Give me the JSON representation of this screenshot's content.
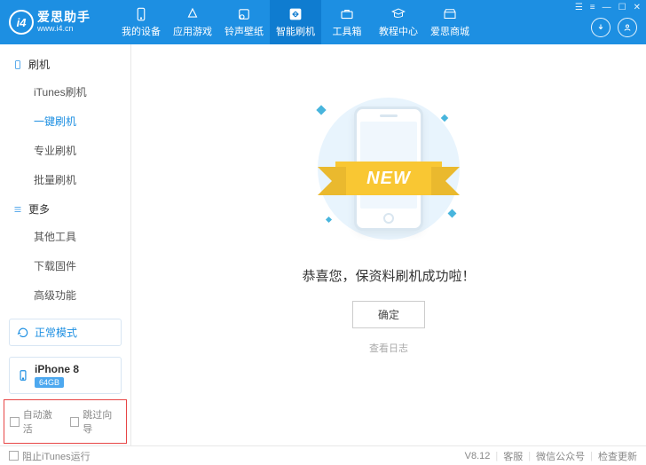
{
  "header": {
    "logo_initials": "i4",
    "logo_title": "爱思助手",
    "logo_url": "www.i4.cn",
    "nav": [
      {
        "label": "我的设备",
        "icon": "device"
      },
      {
        "label": "应用游戏",
        "icon": "apps"
      },
      {
        "label": "铃声壁纸",
        "icon": "ringtone"
      },
      {
        "label": "智能刷机",
        "icon": "flash",
        "active": true
      },
      {
        "label": "工具箱",
        "icon": "toolbox"
      },
      {
        "label": "教程中心",
        "icon": "tutorial"
      },
      {
        "label": "爱思商城",
        "icon": "store"
      }
    ]
  },
  "sidebar": {
    "sections": [
      {
        "title": "刷机",
        "items": [
          "iTunes刷机",
          "一键刷机",
          "专业刷机",
          "批量刷机"
        ],
        "activeIndex": 1
      },
      {
        "title": "更多",
        "items": [
          "其他工具",
          "下载固件",
          "高级功能"
        ],
        "activeIndex": -1
      }
    ],
    "mode_label": "正常模式",
    "device": {
      "name": "iPhone 8",
      "storage": "64GB"
    },
    "bottom_checks": [
      "自动激活",
      "跳过向导"
    ]
  },
  "main": {
    "ribbon_text": "NEW",
    "success_text": "恭喜您，保资料刷机成功啦！",
    "confirm_label": "确定",
    "log_label": "查看日志"
  },
  "status": {
    "left_label": "阻止iTunes运行",
    "version": "V8.12",
    "links": [
      "客服",
      "微信公众号",
      "检查更新"
    ]
  }
}
